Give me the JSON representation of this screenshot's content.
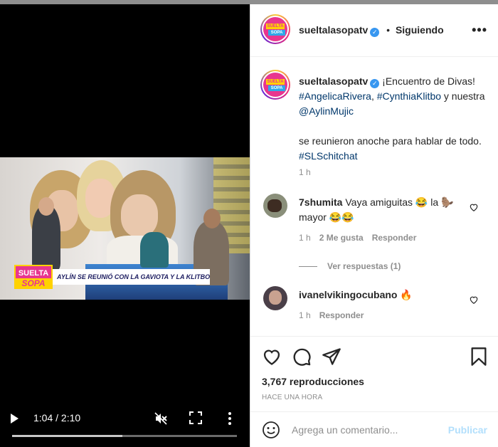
{
  "video": {
    "lower_third_logo_top": "SUELTA",
    "lower_third_logo_bottom": "SOPA",
    "lower_third_text": "AYLÍN SE REUNIÓ CON LA GAVIOTA Y LA KLITBO",
    "time": "1:04 / 2:10",
    "progress": 0.49
  },
  "header": {
    "username": "sueltalasopatv",
    "verified": "✓",
    "dot": "•",
    "follow_label": "Siguiendo",
    "more": "•••",
    "avatar_top": "SUELTA",
    "avatar_bottom": "SOPA"
  },
  "caption": {
    "username": "sueltalasopatv",
    "line1": " ¡Encuentro de Divas!",
    "tag1": "#AngelicaRivera",
    "sep": ", ",
    "tag2": "#CynthiaKlitbo",
    "and": " y nuestra ",
    "mention": "@AylinMujic",
    "line2": "se reunieron anoche para hablar de todo. ",
    "tag3": "#SLSchitchat",
    "time": "1 h"
  },
  "comments": [
    {
      "username": "7shumita",
      "text": " Vaya amiguitas 😂 la 🦫 mayor 😂😂",
      "time": "1 h",
      "likes": "2 Me gusta",
      "reply": "Responder",
      "view_replies": "Ver respuestas (1)"
    },
    {
      "username": "ivanelvikingocubano",
      "text": " 🔥",
      "time": "1 h",
      "reply": "Responder"
    }
  ],
  "stats": {
    "views": "3,767 reproducciones",
    "ago": "HACE UNA HORA"
  },
  "composer": {
    "placeholder": "Agrega un comentario...",
    "publish": "Publicar"
  },
  "colors": {
    "link": "#00376b",
    "muted": "#8e8e8e",
    "publish": "#b2dffc",
    "brand_pink": "#e8368f",
    "brand_yellow": "#ffd200"
  }
}
